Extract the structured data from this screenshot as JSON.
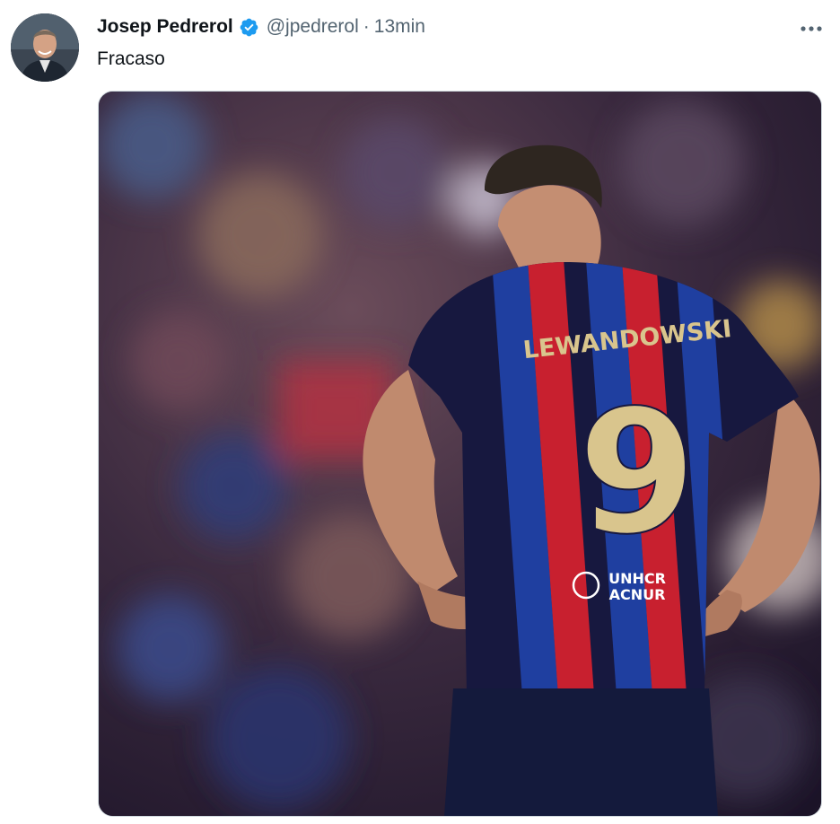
{
  "author": {
    "display_name": "Josep Pedrerol",
    "handle": "@jpedrerol",
    "separator": "·",
    "time": "13min",
    "verified_icon": "verified-badge-icon",
    "verified_color": "#1d9bf0"
  },
  "tweet": {
    "text": "Fracaso"
  },
  "media": {
    "jersey_name": "LEWANDOWSKI",
    "jersey_number": "9",
    "sponsor_line1": "UNHCR",
    "sponsor_line2": "ACNUR"
  },
  "more_icon": "more-horizontal-icon",
  "colors": {
    "text_primary": "#0f1419",
    "text_secondary": "#536471",
    "jersey_blue": "#1f3fa0",
    "jersey_red": "#c8202f",
    "jersey_navy": "#17183f",
    "gold": "#d9c58d"
  }
}
